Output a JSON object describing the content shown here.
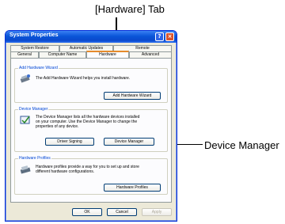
{
  "callouts": {
    "hardware_tab": "[Hardware] Tab",
    "device_manager": "Device Manager"
  },
  "window": {
    "title": "System Properties"
  },
  "tabs": {
    "row1": [
      "System Restore",
      "Automatic Updates",
      "Remote"
    ],
    "row2": [
      "General",
      "Computer Name",
      "Hardware",
      "Advanced"
    ],
    "active": "Hardware"
  },
  "groups": {
    "wizard": {
      "title": "Add Hardware Wizard",
      "desc": "The Add Hardware Wizard helps you install hardware.",
      "button": "Add Hardware Wizard"
    },
    "device_manager": {
      "title": "Device Manager",
      "desc_lines": [
        "The Device Manager lists all the hardware devices installed",
        "on your computer. Use the Device Manager to change the",
        "properties of any device."
      ],
      "signing_button": "Driver Signing",
      "dm_button": "Device Manager"
    },
    "profiles": {
      "title": "Hardware Profiles",
      "desc_lines": [
        "Hardware profiles provide a way for you to set up and store",
        "different hardware configurations."
      ],
      "button": "Hardware Profiles"
    }
  },
  "footer": {
    "ok": "OK",
    "cancel": "Cancel",
    "apply": "Apply"
  }
}
